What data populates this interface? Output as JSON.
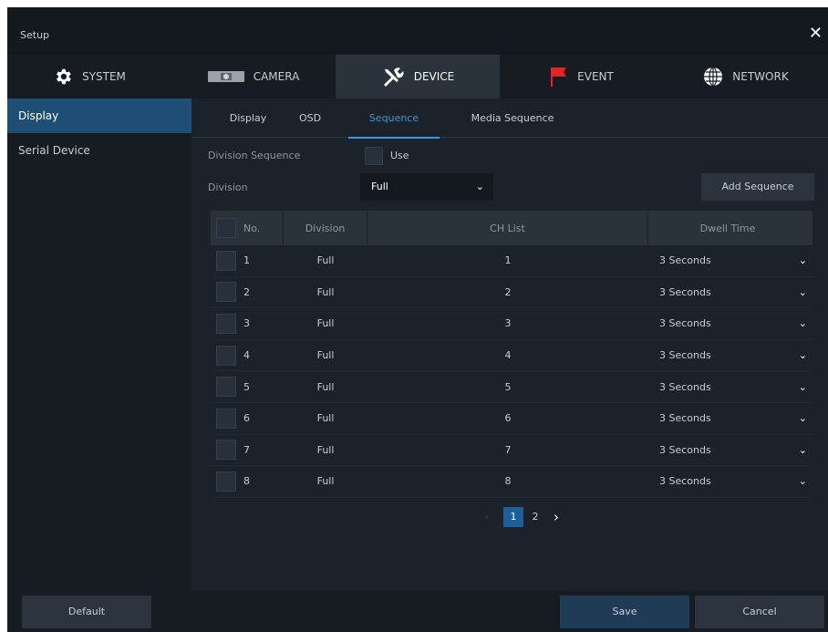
{
  "window": {
    "title": "Setup"
  },
  "tabs": [
    {
      "label": "SYSTEM",
      "icon": "gear-icon"
    },
    {
      "label": "CAMERA",
      "icon": "camera-icon"
    },
    {
      "label": "DEVICE",
      "icon": "tools-icon"
    },
    {
      "label": "EVENT",
      "icon": "flag-icon"
    },
    {
      "label": "NETWORK",
      "icon": "globe-icon"
    }
  ],
  "active_tab": "DEVICE",
  "sidebar": {
    "items": [
      {
        "label": "Display"
      },
      {
        "label": "Serial Device"
      }
    ],
    "active": "Display"
  },
  "subtabs": [
    {
      "label": "Display"
    },
    {
      "label": "OSD"
    },
    {
      "label": "Sequence"
    },
    {
      "label": "Media Sequence"
    }
  ],
  "active_subtab": "Sequence",
  "form": {
    "division_sequence_label": "Division Sequence",
    "use_label": "Use",
    "use_checked": false,
    "division_label": "Division",
    "division_value": "Full",
    "add_sequence_label": "Add Sequence"
  },
  "table": {
    "headers": {
      "no": "No.",
      "division": "Division",
      "ch_list": "CH List",
      "dwell_time": "Dwell Time"
    },
    "rows": [
      {
        "no": "1",
        "division": "Full",
        "ch": "1",
        "dwell": "3 Seconds"
      },
      {
        "no": "2",
        "division": "Full",
        "ch": "2",
        "dwell": "3 Seconds"
      },
      {
        "no": "3",
        "division": "Full",
        "ch": "3",
        "dwell": "3 Seconds"
      },
      {
        "no": "4",
        "division": "Full",
        "ch": "4",
        "dwell": "3 Seconds"
      },
      {
        "no": "5",
        "division": "Full",
        "ch": "5",
        "dwell": "3 Seconds"
      },
      {
        "no": "6",
        "division": "Full",
        "ch": "6",
        "dwell": "3 Seconds"
      },
      {
        "no": "7",
        "division": "Full",
        "ch": "7",
        "dwell": "3 Seconds"
      },
      {
        "no": "8",
        "division": "Full",
        "ch": "8",
        "dwell": "3 Seconds"
      }
    ]
  },
  "pager": {
    "prev": "‹",
    "pages": [
      "1",
      "2"
    ],
    "current": "1",
    "next": "›"
  },
  "footer": {
    "default_label": "Default",
    "save_label": "Save",
    "cancel_label": "Cancel"
  },
  "colors": {
    "accent": "#3a97d8",
    "selected_bg": "#1e4e73",
    "event_flag": "#e0242a"
  }
}
